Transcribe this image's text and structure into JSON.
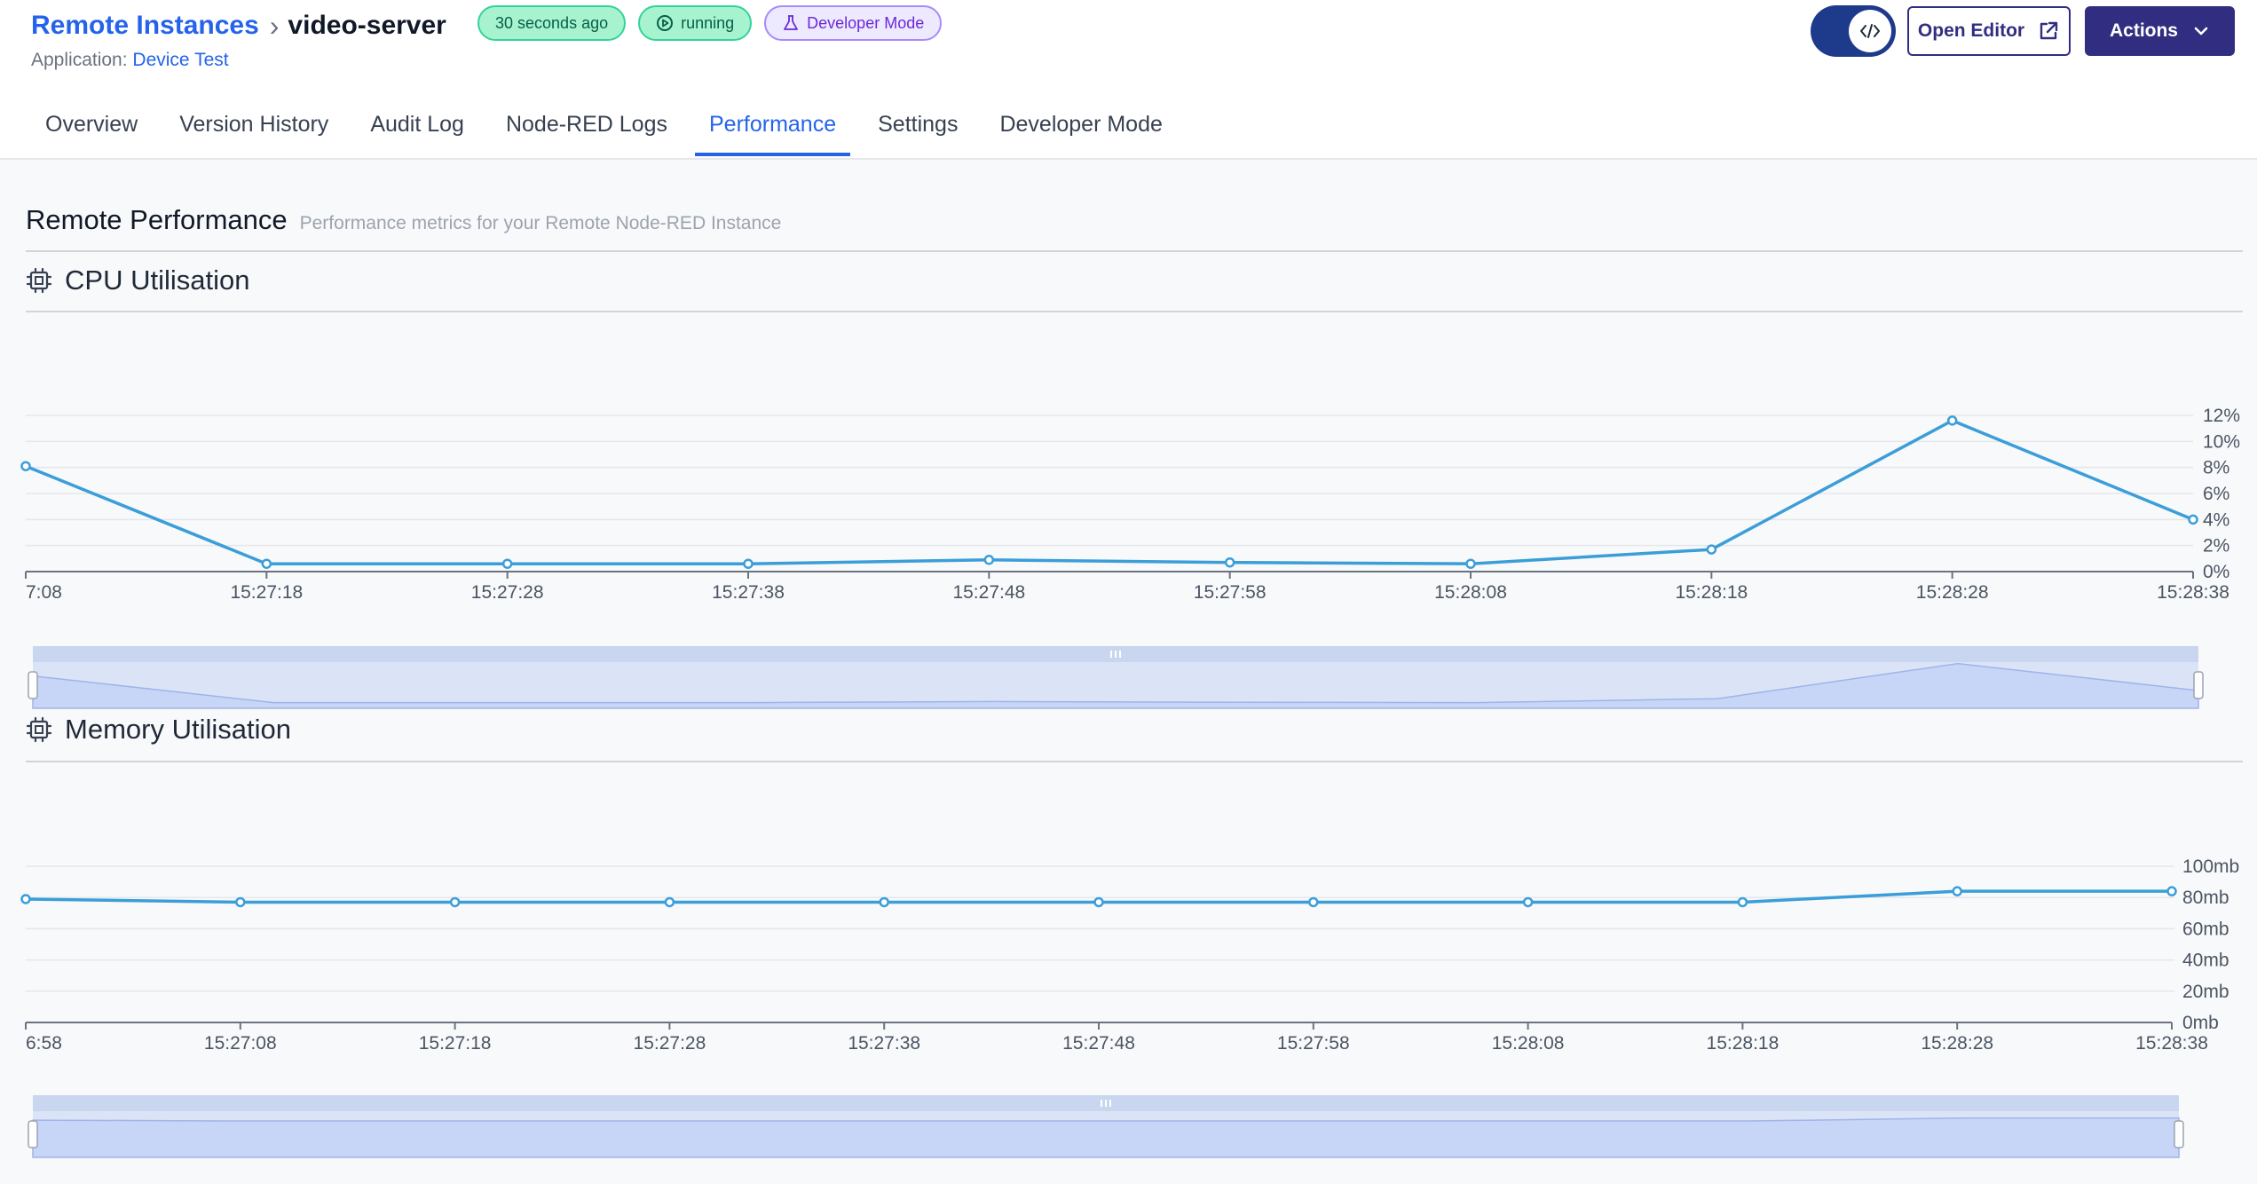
{
  "breadcrumb": {
    "parent": "Remote Instances",
    "current": "video-server"
  },
  "badges": {
    "updated": "30 seconds ago",
    "status": "running",
    "mode": "Developer Mode"
  },
  "application": {
    "label": "Application:",
    "name": "Device Test"
  },
  "buttons": {
    "open_editor": "Open Editor",
    "actions": "Actions"
  },
  "tabs": [
    "Overview",
    "Version History",
    "Audit Log",
    "Node-RED Logs",
    "Performance",
    "Settings",
    "Developer Mode"
  ],
  "active_tab": "Performance",
  "section": {
    "title": "Remote Performance",
    "subtitle": "Performance metrics for your Remote Node-RED Instance"
  },
  "colors": {
    "accent": "#2563eb",
    "line": "#3b9ed8",
    "brand": "#312e81"
  },
  "icons": {
    "chip": "cpu-chip-icon",
    "external": "external-link-icon",
    "chevron": "chevron-down-icon",
    "code": "code-icon"
  },
  "chart_data": [
    {
      "type": "line",
      "title": "CPU Utilisation",
      "x": [
        "7:08",
        "15:27:18",
        "15:27:28",
        "15:27:38",
        "15:27:48",
        "15:27:58",
        "15:28:08",
        "15:28:18",
        "15:28:28",
        "15:28:38"
      ],
      "values": [
        8.1,
        0.6,
        0.6,
        0.6,
        0.9,
        0.7,
        0.6,
        1.7,
        11.6,
        4.0
      ],
      "y_ticks": [
        "0%",
        "2%",
        "4%",
        "6%",
        "8%",
        "10%",
        "12%"
      ],
      "ylim": [
        0,
        12
      ],
      "y_axis_side": "right",
      "grid": true,
      "zoom_slider": true
    },
    {
      "type": "line",
      "title": "Memory Utilisation",
      "x": [
        "6:58",
        "15:27:08",
        "15:27:18",
        "15:27:28",
        "15:27:38",
        "15:27:48",
        "15:27:58",
        "15:28:08",
        "15:28:18",
        "15:28:28",
        "15:28:38"
      ],
      "values": [
        79,
        77,
        77,
        77,
        77,
        77,
        77,
        77,
        77,
        84,
        84
      ],
      "y_ticks": [
        "0mb",
        "20mb",
        "40mb",
        "60mb",
        "80mb",
        "100mb"
      ],
      "ylim": [
        0,
        100
      ],
      "y_axis_side": "right",
      "grid": true,
      "zoom_slider": true
    }
  ]
}
